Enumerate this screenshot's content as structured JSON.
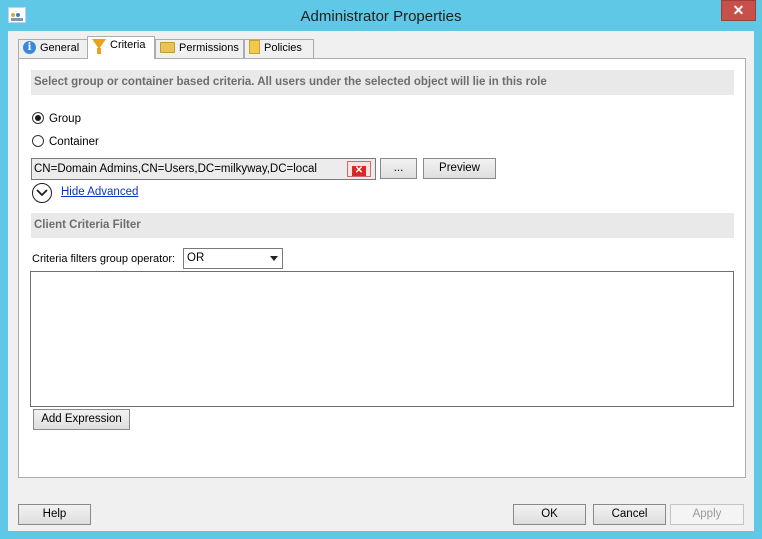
{
  "window": {
    "title": "Administrator Properties",
    "close_glyph": "✕"
  },
  "tabs": [
    {
      "label": "General",
      "icon": "info-icon"
    },
    {
      "label": "Criteria",
      "icon": "funnel-icon",
      "active": true
    },
    {
      "label": "Permissions",
      "icon": "folder-icon"
    },
    {
      "label": "Policies",
      "icon": "policy-icon"
    }
  ],
  "criteria": {
    "description": "Select group or container based criteria. All users under the selected object will lie in this role",
    "radio_group_label": "Group",
    "radio_container_label": "Container",
    "selected": "Group",
    "path_value": "CN=Domain Admins,CN=Users,DC=milkyway,DC=local",
    "browse_label": "...",
    "preview_label": "Preview",
    "hide_advanced_label": "Hide Advanced"
  },
  "client_filter": {
    "header": "Client Criteria Filter",
    "operator_label": "Criteria filters group operator:",
    "operator_value": "OR",
    "add_expression_label": "Add Expression"
  },
  "footer": {
    "help": "Help",
    "ok": "OK",
    "cancel": "Cancel",
    "apply": "Apply"
  },
  "colors": {
    "title_bar": "#5fc8e6",
    "close_button": "#c7504a",
    "link": "#0a33c9"
  }
}
